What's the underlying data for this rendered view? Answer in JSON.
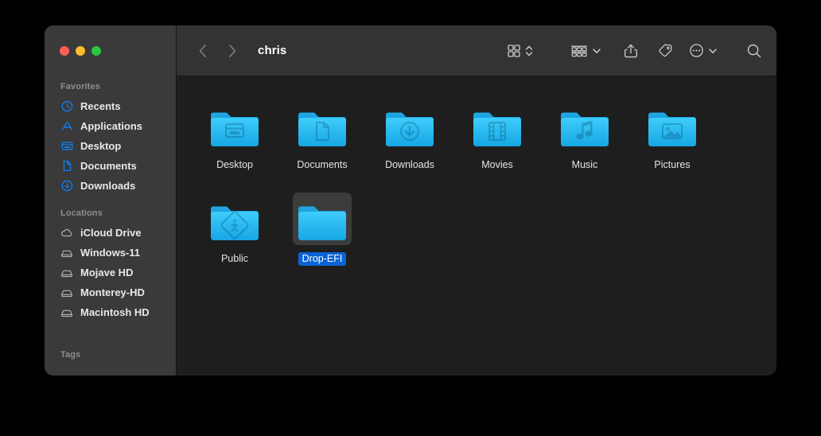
{
  "window": {
    "title": "chris",
    "traffic_lights": [
      {
        "name": "close",
        "color": "#ff5f57"
      },
      {
        "name": "minimize",
        "color": "#febc2e"
      },
      {
        "name": "zoom",
        "color": "#28c840"
      }
    ]
  },
  "toolbar": {
    "back_icon": "chevron-left-icon",
    "forward_icon": "chevron-right-icon",
    "items": [
      {
        "name": "view-grid-button",
        "icon": "grid-view-icon"
      },
      {
        "name": "view-options-stepper",
        "icon": "chevron-up-down-icon"
      },
      {
        "name": "group-by-button",
        "icon": "group-by-icon"
      },
      {
        "name": "group-by-chevron",
        "icon": "chevron-down-icon"
      },
      {
        "name": "share-button",
        "icon": "share-icon"
      },
      {
        "name": "tag-button",
        "icon": "tag-icon"
      },
      {
        "name": "more-actions-button",
        "icon": "ellipsis-circle-icon"
      },
      {
        "name": "more-actions-chevron",
        "icon": "chevron-down-icon"
      },
      {
        "name": "search-button",
        "icon": "search-icon"
      }
    ]
  },
  "sidebar": {
    "sections": [
      {
        "header": "Favorites",
        "items": [
          {
            "label": "Recents",
            "icon": "clock-icon",
            "color": "#0a84ff"
          },
          {
            "label": "Applications",
            "icon": "applications-icon",
            "color": "#0a84ff"
          },
          {
            "label": "Desktop",
            "icon": "desktop-window-icon",
            "color": "#0a84ff"
          },
          {
            "label": "Documents",
            "icon": "document-icon",
            "color": "#0a84ff"
          },
          {
            "label": "Downloads",
            "icon": "download-circle-icon",
            "color": "#0a84ff"
          }
        ]
      },
      {
        "header": "Locations",
        "items": [
          {
            "label": "iCloud Drive",
            "icon": "cloud-icon",
            "color": "#b4b4b4"
          },
          {
            "label": "Windows-11",
            "icon": "hard-drive-icon",
            "color": "#b4b4b4"
          },
          {
            "label": "Mojave HD",
            "icon": "hard-drive-icon",
            "color": "#b4b4b4"
          },
          {
            "label": "Monterey-HD",
            "icon": "hard-drive-icon",
            "color": "#b4b4b4"
          },
          {
            "label": "Macintosh HD",
            "icon": "hard-drive-icon",
            "color": "#b4b4b4"
          }
        ]
      },
      {
        "header": "Tags",
        "items": []
      }
    ]
  },
  "content": {
    "rows": [
      [
        {
          "label": "Desktop",
          "glyph": "desktop-window-glyph",
          "selected": false
        },
        {
          "label": "Documents",
          "glyph": "document-glyph",
          "selected": false
        },
        {
          "label": "Downloads",
          "glyph": "download-arrow-glyph",
          "selected": false
        },
        {
          "label": "Movies",
          "glyph": "film-strip-glyph",
          "selected": false
        },
        {
          "label": "Music",
          "glyph": "music-note-glyph",
          "selected": false
        },
        {
          "label": "Pictures",
          "glyph": "photo-glyph",
          "selected": false
        }
      ],
      [
        {
          "label": "Public",
          "glyph": "walk-sign-glyph",
          "selected": false
        },
        {
          "label": "Drop-EFI",
          "glyph": "none",
          "selected": true
        }
      ]
    ]
  },
  "colors": {
    "accent_blue": "#0a84ff",
    "selection_blue": "#0a63d6",
    "folder_blue": "#21b5f0",
    "sidebar_bg": "#3a3a3a",
    "content_bg": "#1e1e1e",
    "toolbar_bg": "#333333"
  }
}
